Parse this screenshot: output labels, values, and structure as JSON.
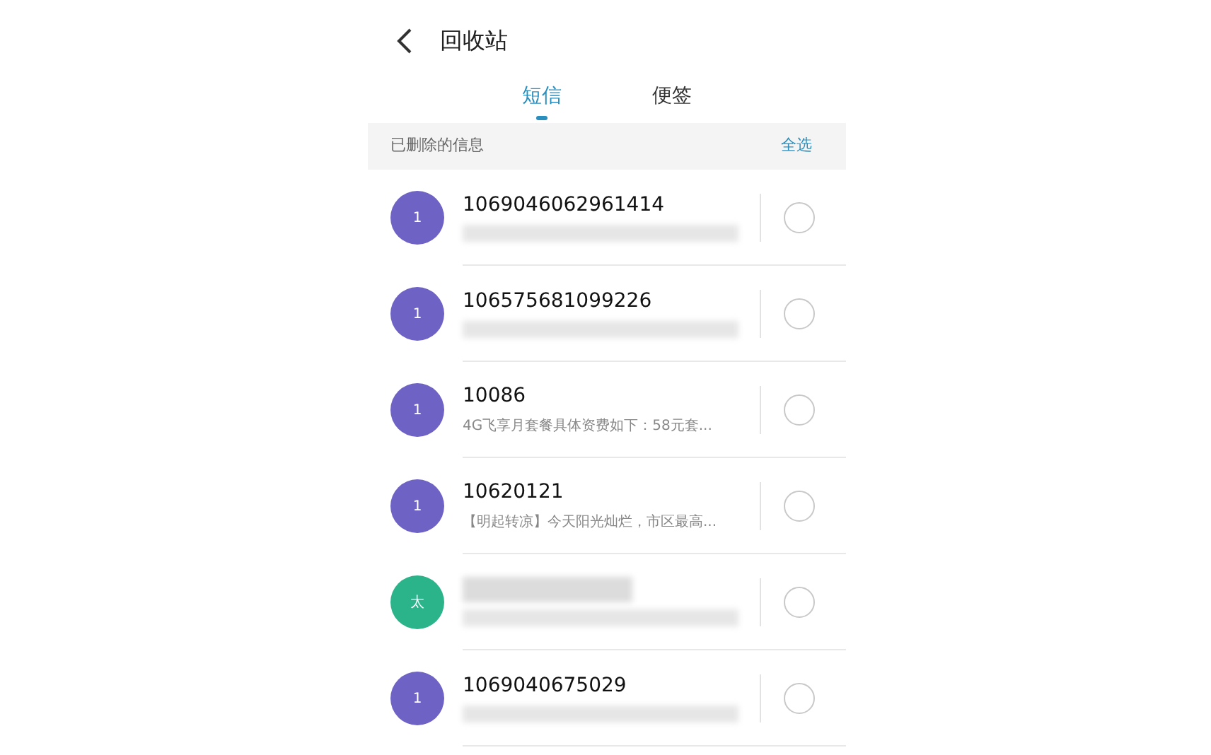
{
  "header": {
    "title": "回收站"
  },
  "tabs": [
    {
      "label": "短信",
      "selected": true
    },
    {
      "label": "便签",
      "selected": false
    }
  ],
  "section": {
    "label": "已删除的信息",
    "action": "全选"
  },
  "messages": [
    {
      "avatar": "1",
      "color": "#6e62c4",
      "name": "1069046062961414",
      "checked": false
    },
    {
      "avatar": "1",
      "color": "#6e62c4",
      "name": "106575681099226",
      "checked": false
    },
    {
      "avatar": "1",
      "color": "#6e62c4",
      "name": "10086",
      "preview": "4G飞享月套餐具体资费如下：58元套...",
      "checked": false
    },
    {
      "avatar": "1",
      "color": "#6e62c4",
      "name": "10620121",
      "preview": "【明起转凉】今天阳光灿烂，市区最高...",
      "checked": false
    },
    {
      "avatar": "太",
      "color": "#2bb38a",
      "checked": false
    },
    {
      "avatar": "1",
      "color": "#6e62c4",
      "name": "1069040675029",
      "checked": false
    }
  ]
}
